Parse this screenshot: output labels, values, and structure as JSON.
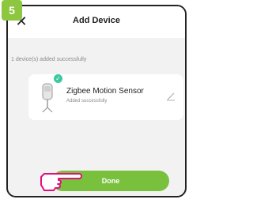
{
  "step": {
    "number": "5"
  },
  "header": {
    "title": "Add Device",
    "close_icon": "close-icon"
  },
  "status": {
    "text": "1 device(s) added successfully"
  },
  "device": {
    "name": "Zigbee Motion Sensor",
    "status": "Added successfully",
    "icon": "motion-sensor-icon",
    "badge_icon": "check-icon",
    "edit_icon": "edit-icon"
  },
  "actions": {
    "done_label": "Done"
  },
  "pointer": {
    "icon": "hand-pointer-icon"
  },
  "colors": {
    "accent": "#79c03d",
    "step_badge": "#8dc63f",
    "check": "#3ec7a0"
  }
}
